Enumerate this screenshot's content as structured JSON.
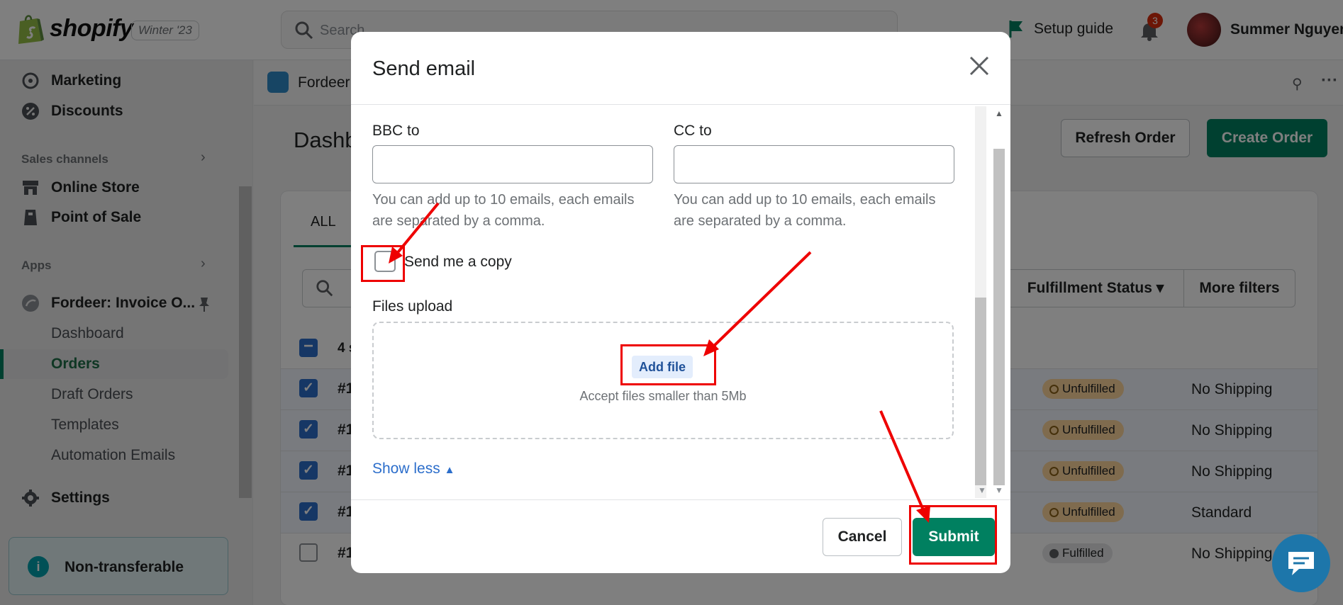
{
  "topbar": {
    "brand": "shopify",
    "edition": "Winter '23",
    "search_placeholder": "Search",
    "setup_guide": "Setup guide",
    "notifications_count": "3",
    "user_name": "Summer Nguyen"
  },
  "sidebar": {
    "items": {
      "marketing": "Marketing",
      "discounts": "Discounts",
      "online_store": "Online Store",
      "point_of_sale": "Point of Sale",
      "settings": "Settings"
    },
    "sales_channels": "Sales channels",
    "apps": "Apps",
    "app_name": "Fordeer: Invoice O...",
    "sub_items": [
      "Dashboard",
      "Orders",
      "Draft Orders",
      "Templates",
      "Automation Emails"
    ],
    "active_sub_item": "Orders",
    "non_transferable": "Non-transferable"
  },
  "main": {
    "app_header": "Fordeer:",
    "page_title": "Dashb",
    "refresh_button": "Refresh Order",
    "create_button": "Create Order",
    "tab_all": "ALL",
    "fulfillment_filter": "Fulfillment Status",
    "more_filters": "More filters",
    "selected_count": "4 s",
    "rows": [
      {
        "order": "#1",
        "status": "Unfulfilled",
        "shipping": "No Shipping",
        "checked": true
      },
      {
        "order": "#1",
        "status": "Unfulfilled",
        "shipping": "No Shipping",
        "checked": true
      },
      {
        "order": "#1",
        "status": "Unfulfilled",
        "shipping": "No Shipping",
        "checked": true
      },
      {
        "order": "#1",
        "status": "Unfulfilled",
        "shipping": "Standard",
        "checked": true
      },
      {
        "order": "#1",
        "status": "Fulfilled",
        "shipping": "No Shipping",
        "checked": false
      }
    ]
  },
  "modal": {
    "title": "Send email",
    "bcc_label": "BBC to",
    "cc_label": "CC to",
    "help_text": "You can add up to 10 emails, each emails are separated by a comma.",
    "send_copy_label": "Send me a copy",
    "files_upload_label": "Files upload",
    "add_file": "Add file",
    "accept_text": "Accept files smaller than 5Mb",
    "show_less": "Show less",
    "cancel": "Cancel",
    "submit": "Submit"
  },
  "colors": {
    "primary_green": "#008060",
    "annotation_red": "#ee0000",
    "link_blue": "#2c6ecb"
  }
}
